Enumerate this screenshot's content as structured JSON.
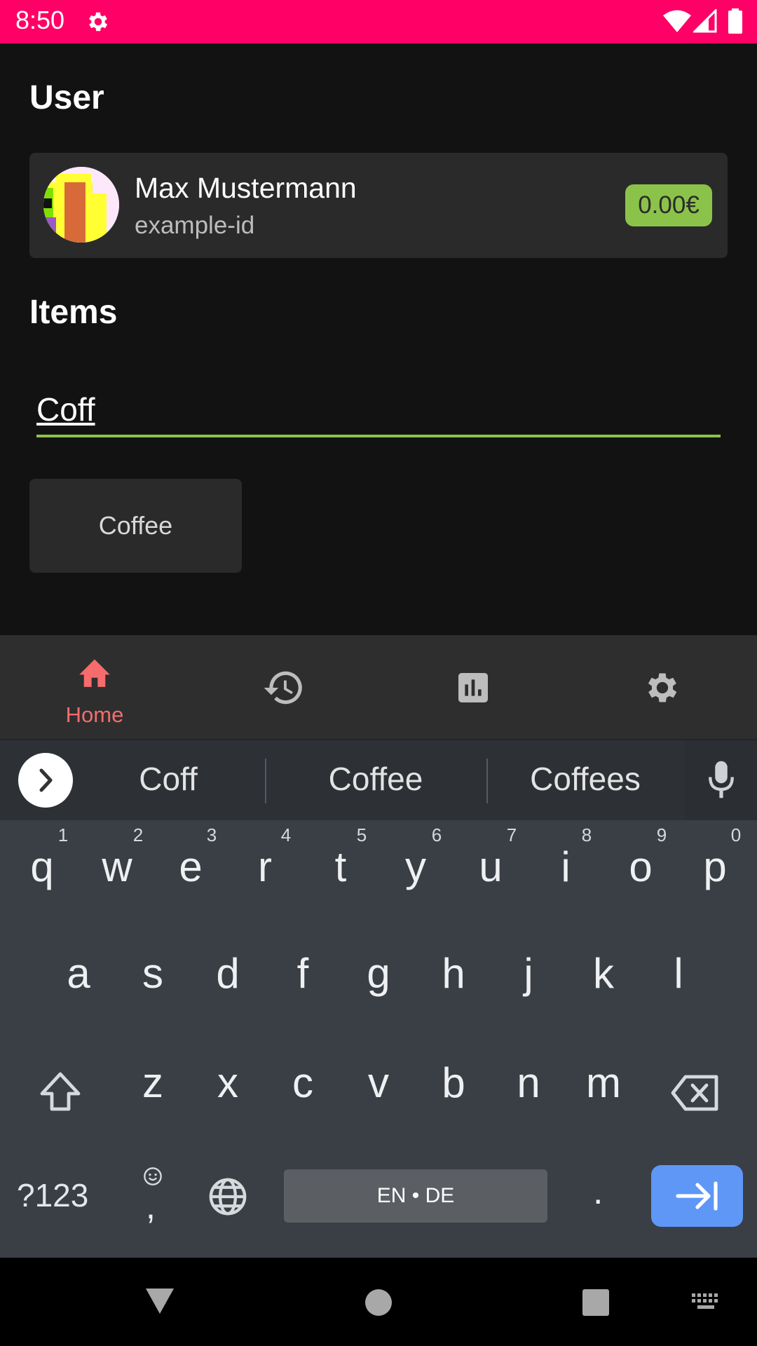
{
  "status_bar": {
    "time": "8:50",
    "color": "#FF0066"
  },
  "user_section": {
    "heading": "User",
    "name": "Max Mustermann",
    "id": "example-id",
    "balance": "0.00€",
    "balance_color": "#8BC34A"
  },
  "items_section": {
    "heading": "Items",
    "search_value": "Coff",
    "items": [
      "Coffee"
    ]
  },
  "bottom_nav": {
    "home_label": "Home",
    "icons": [
      "home-icon",
      "history-icon",
      "chart-icon",
      "settings-icon"
    ],
    "active_color": "#F56C6C"
  },
  "keyboard": {
    "suggestions": [
      "Coff",
      "Coffee",
      "Coffees"
    ],
    "row1": [
      "q",
      "w",
      "e",
      "r",
      "t",
      "y",
      "u",
      "i",
      "o",
      "p"
    ],
    "row1_hints": [
      "1",
      "2",
      "3",
      "4",
      "5",
      "6",
      "7",
      "8",
      "9",
      "0"
    ],
    "row2": [
      "a",
      "s",
      "d",
      "f",
      "g",
      "h",
      "j",
      "k",
      "l"
    ],
    "row3": [
      "z",
      "x",
      "c",
      "v",
      "b",
      "n",
      "m"
    ],
    "symbols_label": "?123",
    "comma_label": ",",
    "space_label": "EN • DE",
    "period_label": "."
  }
}
